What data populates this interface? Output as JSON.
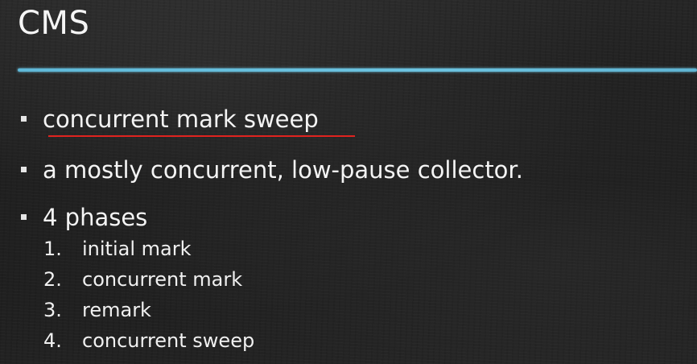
{
  "slide": {
    "title": "CMS",
    "accent_color": "#6cc3e0",
    "underline_color": "#e0231f"
  },
  "bullets": [
    {
      "text": "concurrent mark sweep"
    },
    {
      "text": "a mostly concurrent, low-pause collector."
    },
    {
      "text": "4 phases"
    }
  ],
  "phases": [
    {
      "number": "1.",
      "label": "initial mark"
    },
    {
      "number": "2.",
      "label": "concurrent mark"
    },
    {
      "number": "3.",
      "label": "remark"
    },
    {
      "number": "4.",
      "label": "concurrent sweep"
    }
  ]
}
